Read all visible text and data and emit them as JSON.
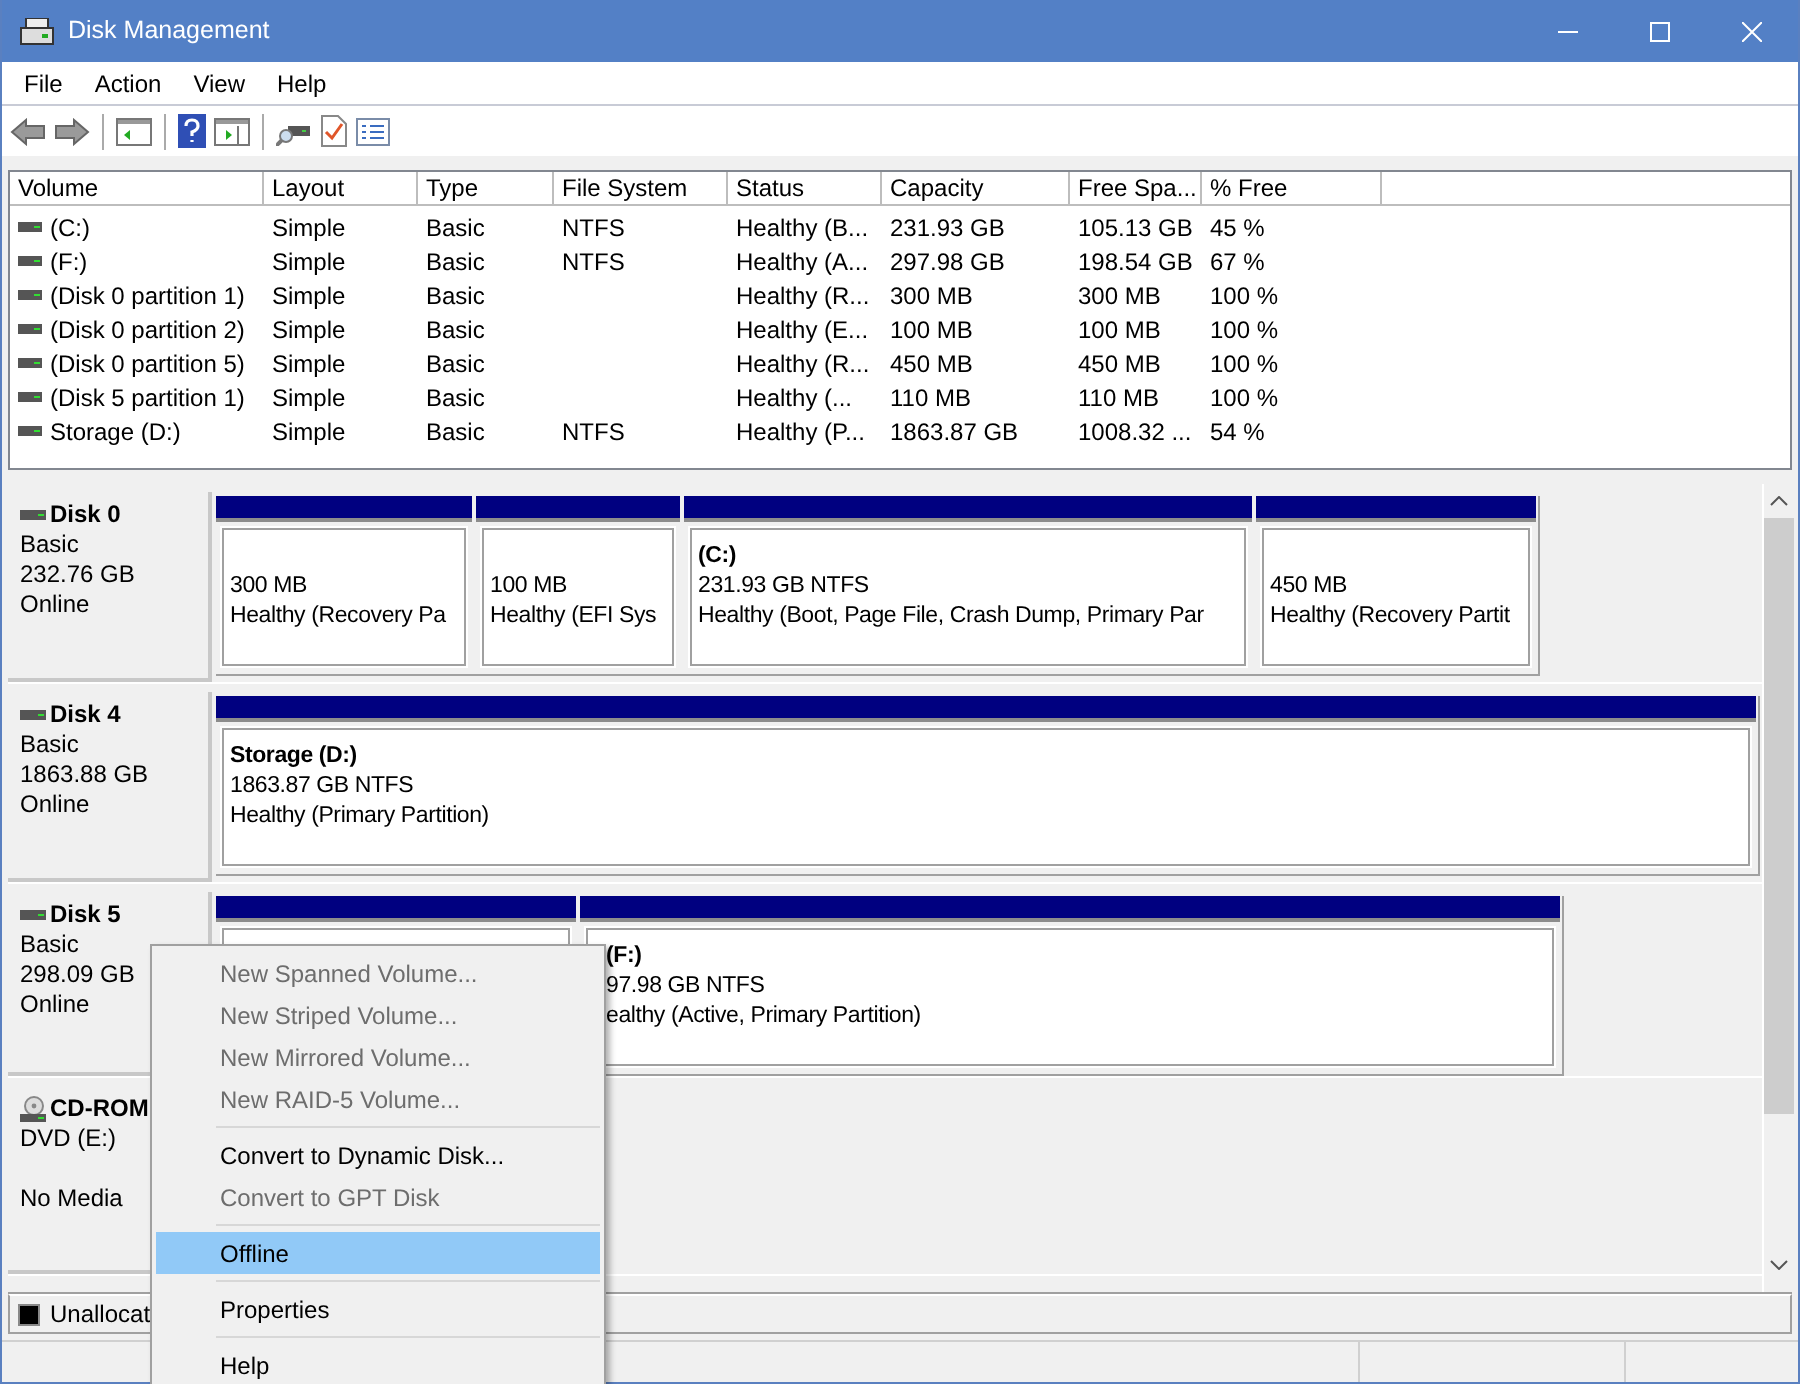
{
  "window": {
    "title": "Disk Management"
  },
  "menu": [
    "File",
    "Action",
    "View",
    "Help"
  ],
  "volume_table": {
    "columns": [
      "Volume",
      "Layout",
      "Type",
      "File System",
      "Status",
      "Capacity",
      "Free Spa...",
      "% Free"
    ],
    "rows": [
      {
        "cells": [
          "(C:)",
          "Simple",
          "Basic",
          "NTFS",
          "Healthy (B...",
          "231.93 GB",
          "105.13 GB",
          "45 %"
        ]
      },
      {
        "cells": [
          "(F:)",
          "Simple",
          "Basic",
          "NTFS",
          "Healthy (A...",
          "297.98 GB",
          "198.54 GB",
          "67 %"
        ]
      },
      {
        "cells": [
          "(Disk 0 partition 1)",
          "Simple",
          "Basic",
          "",
          "Healthy (R...",
          "300 MB",
          "300 MB",
          "100 %"
        ]
      },
      {
        "cells": [
          "(Disk 0 partition 2)",
          "Simple",
          "Basic",
          "",
          "Healthy (E...",
          "100 MB",
          "100 MB",
          "100 %"
        ]
      },
      {
        "cells": [
          "(Disk 0 partition 5)",
          "Simple",
          "Basic",
          "",
          "Healthy (R...",
          "450 MB",
          "450 MB",
          "100 %"
        ]
      },
      {
        "cells": [
          "(Disk 5 partition 1)",
          "Simple",
          "Basic",
          "",
          "Healthy (...",
          "110 MB",
          "110 MB",
          "100 %"
        ]
      },
      {
        "cells": [
          "Storage (D:)",
          "Simple",
          "Basic",
          "NTFS",
          "Healthy (P...",
          "1863.87 GB",
          "1008.32 ...",
          "54 %"
        ]
      }
    ]
  },
  "disks": [
    {
      "kind": "disk",
      "name": "Disk 0",
      "type": "Basic",
      "size": "232.76 GB",
      "status": "Online",
      "partitions": [
        {
          "kind": "volume",
          "size": "300 MB",
          "health": "Healthy (Recovery Pa"
        },
        {
          "kind": "volume",
          "size": "100 MB",
          "health": "Healthy (EFI Sys"
        },
        {
          "kind": "volume",
          "label": "(C:)",
          "size": "231.93 GB NTFS",
          "health": "Healthy (Boot, Page File, Crash Dump, Primary Par"
        },
        {
          "kind": "volume",
          "size": "450 MB",
          "health": "Healthy (Recovery Partit"
        }
      ]
    },
    {
      "kind": "disk",
      "name": "Disk 4",
      "type": "Basic",
      "size": "1863.88 GB",
      "status": "Online",
      "partitions": [
        {
          "kind": "volume",
          "label": "Storage  (D:)",
          "size": "1863.87 GB NTFS",
          "health": "Healthy (Primary Partition)"
        }
      ]
    },
    {
      "kind": "disk",
      "name": "Disk 5",
      "type": "Basic",
      "size": "298.09 GB",
      "status": "Online",
      "partitions": [
        {
          "kind": "covered"
        },
        {
          "kind": "volume",
          "label": "(F:)",
          "size": "97.98 GB NTFS",
          "health": "ealthy (Active, Primary Partition)"
        }
      ]
    },
    {
      "kind": "cdrom",
      "name": "CD-ROM",
      "type": "DVD (E:)",
      "status": "No Media"
    }
  ],
  "legend": [
    {
      "label": "Unallocat",
      "color": "#000000"
    }
  ],
  "context_menu": [
    {
      "kind": "item",
      "label": "New Spanned Volume...",
      "disabled": true,
      "selected": false
    },
    {
      "kind": "item",
      "label": "New Striped Volume...",
      "disabled": true,
      "selected": false
    },
    {
      "kind": "item",
      "label": "New Mirrored Volume...",
      "disabled": true,
      "selected": false
    },
    {
      "kind": "item",
      "label": "New RAID-5 Volume...",
      "disabled": true,
      "selected": false
    },
    {
      "kind": "separator"
    },
    {
      "kind": "item",
      "label": "Convert to Dynamic Disk...",
      "disabled": false,
      "selected": false
    },
    {
      "kind": "item",
      "label": "Convert to GPT Disk",
      "disabled": true,
      "selected": false
    },
    {
      "kind": "separator"
    },
    {
      "kind": "item",
      "label": "Offline",
      "disabled": false,
      "selected": true
    },
    {
      "kind": "separator"
    },
    {
      "kind": "item",
      "label": "Properties",
      "disabled": false,
      "selected": false
    },
    {
      "kind": "separator"
    },
    {
      "kind": "item",
      "label": "Help",
      "disabled": false,
      "selected": false
    }
  ]
}
